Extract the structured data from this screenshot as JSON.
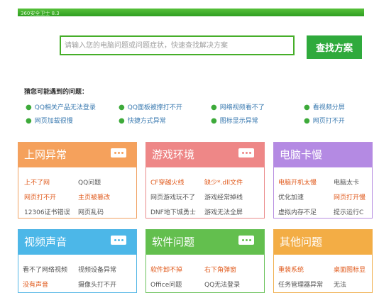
{
  "window": {
    "title": "360安全卫士 8.3"
  },
  "search": {
    "placeholder": "请输入您的电脑问题或问题症状，快速查找解决方案",
    "button_label": "查找方案"
  },
  "questions": {
    "title": "猜您可能遇到的问题：",
    "items": [
      "QQ相关产品无法登录",
      "QQ面板被撑打不开",
      "网络视频看不了",
      "看视频分屏",
      "网页加载很慢",
      "快捷方式异常",
      "图标显示异常",
      "网页打不开"
    ]
  },
  "cards": [
    {
      "title": "上网异常",
      "links": [
        "上不了网",
        "QQ问题",
        "网页打不开",
        "主页被篡改",
        "12306证书错误",
        "网页乱码"
      ]
    },
    {
      "title": "游戏环境",
      "links": [
        "CF穿越火线",
        "缺少*.dll文件",
        "网页游戏玩不了",
        "游戏经常掉线",
        "DNF地下城勇士",
        "游戏无法全屏"
      ]
    },
    {
      "title": "电脑卡慢",
      "links": [
        "电脑开机太慢",
        "电脑太卡",
        "优化加速",
        "网页打开慢",
        "虚拟内存不足",
        "提示运行C"
      ]
    },
    {
      "title": "视频声音",
      "links": [
        "看不了网络视频",
        "视频设备异常",
        "没有声音",
        "摄像头打不开"
      ]
    },
    {
      "title": "软件问题",
      "links": [
        "软件卸不掉",
        "右下角弹窗",
        "Office问题",
        "QQ无法登录"
      ]
    },
    {
      "title": "其他问题",
      "links": [
        "重装系统",
        "桌面图标显",
        "任务管理器异常",
        "无法"
      ]
    }
  ]
}
